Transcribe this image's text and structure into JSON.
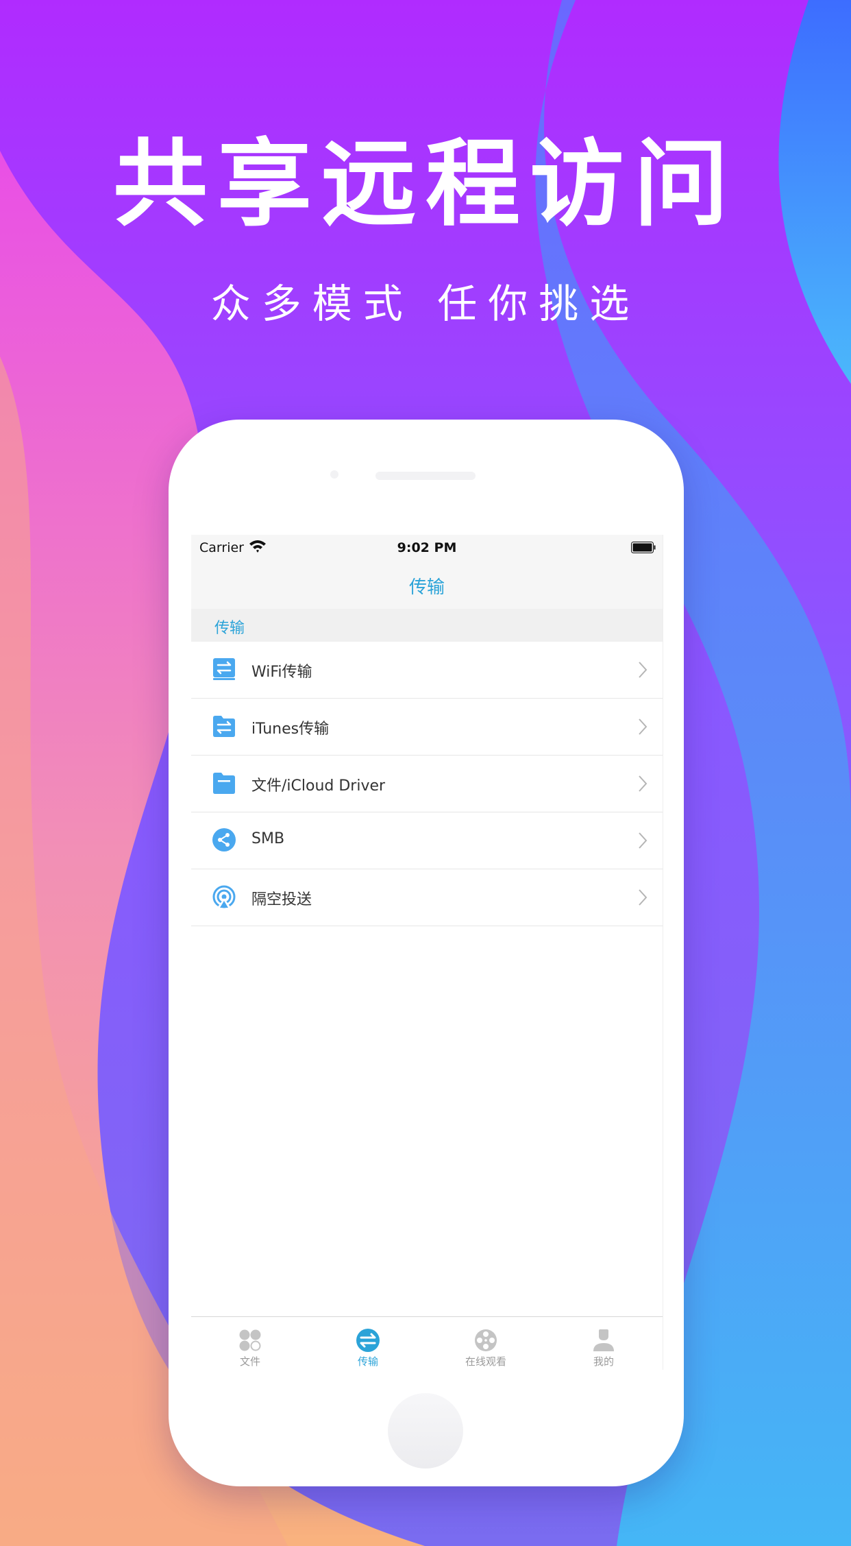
{
  "banner": {
    "headline": "共享远程访问",
    "subline": "众多模式 任你挑选"
  },
  "status_bar": {
    "carrier": "Carrier",
    "time": "9:02 PM"
  },
  "nav": {
    "title": "传输"
  },
  "section": {
    "label": "传输"
  },
  "items": [
    {
      "label": "WiFi传输",
      "icon": "wifi-transfer-icon"
    },
    {
      "label": "iTunes传输",
      "icon": "itunes-transfer-icon"
    },
    {
      "label": "文件/iCloud Driver",
      "icon": "folder-icon"
    },
    {
      "label": "SMB",
      "icon": "share-icon"
    },
    {
      "label": "隔空投送",
      "icon": "airdrop-icon"
    }
  ],
  "tabs": [
    {
      "label": "文件",
      "icon": "files-icon",
      "active": false
    },
    {
      "label": "传输",
      "icon": "transfer-icon",
      "active": true
    },
    {
      "label": "在线观看",
      "icon": "film-reel-icon",
      "active": false
    },
    {
      "label": "我的",
      "icon": "profile-icon",
      "active": false
    }
  ],
  "colors": {
    "accent": "#2ba3d8",
    "icon_blue": "#4aa8ef",
    "tab_inactive": "#c4c4c4"
  }
}
